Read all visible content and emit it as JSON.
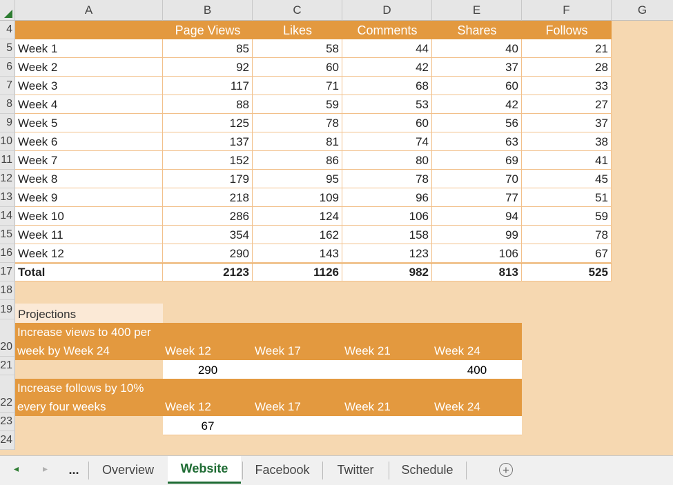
{
  "columns": [
    "A",
    "B",
    "C",
    "D",
    "E",
    "F",
    "G"
  ],
  "row_numbers": [
    "4",
    "5",
    "6",
    "7",
    "8",
    "9",
    "10",
    "11",
    "12",
    "13",
    "14",
    "15",
    "16",
    "17",
    "18",
    "19",
    "20",
    "21",
    "22",
    "23",
    "24"
  ],
  "table": {
    "headers": [
      "",
      "Page Views",
      "Likes",
      "Comments",
      "Shares",
      "Follows"
    ],
    "rows": [
      [
        "Week 1",
        "85",
        "58",
        "44",
        "40",
        "21"
      ],
      [
        "Week 2",
        "92",
        "60",
        "42",
        "37",
        "28"
      ],
      [
        "Week 3",
        "117",
        "71",
        "68",
        "60",
        "33"
      ],
      [
        "Week 4",
        "88",
        "59",
        "53",
        "42",
        "27"
      ],
      [
        "Week 5",
        "125",
        "78",
        "60",
        "56",
        "37"
      ],
      [
        "Week 6",
        "137",
        "81",
        "74",
        "63",
        "38"
      ],
      [
        "Week 7",
        "152",
        "86",
        "80",
        "69",
        "41"
      ],
      [
        "Week 8",
        "179",
        "95",
        "78",
        "70",
        "45"
      ],
      [
        "Week 9",
        "218",
        "109",
        "96",
        "77",
        "51"
      ],
      [
        "Week 10",
        "286",
        "124",
        "106",
        "94",
        "59"
      ],
      [
        "Week 11",
        "354",
        "162",
        "158",
        "99",
        "78"
      ],
      [
        "Week 12",
        "290",
        "143",
        "123",
        "106",
        "67"
      ]
    ],
    "total": [
      "Total",
      "2123",
      "1126",
      "982",
      "813",
      "525"
    ]
  },
  "projections": {
    "label": "Projections",
    "views": {
      "goal_line1": "Increase views to 400 per",
      "goal_line2": "week by Week 24",
      "weeks": [
        "Week 12",
        "Week 17",
        "Week 21",
        "Week 24"
      ],
      "values": [
        "290",
        "",
        "",
        "400"
      ]
    },
    "follows": {
      "goal_line1": "Increase follows by 10%",
      "goal_line2": "every four weeks",
      "weeks": [
        "Week 12",
        "Week 17",
        "Week 21",
        "Week 24"
      ],
      "values": [
        "67",
        "",
        "",
        ""
      ]
    }
  },
  "sheet_tabs": {
    "nav_prev": "◂",
    "nav_next": "▸",
    "more": "...",
    "tabs": [
      "Overview",
      "Website",
      "Facebook",
      "Twitter",
      "Schedule"
    ],
    "active": "Website",
    "add": "+"
  },
  "colors": {
    "accent": "#e3993f",
    "background": "#f6d8b1",
    "active_tab": "#1e6b33"
  }
}
